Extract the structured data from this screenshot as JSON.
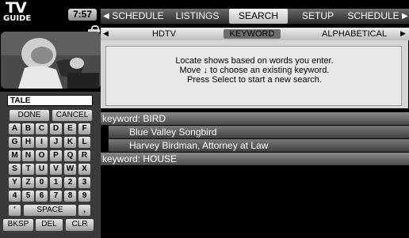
{
  "logo": {
    "line1": "TV",
    "line2": "GUIDE"
  },
  "clock": "7:57",
  "top_nav": {
    "items": [
      {
        "label": "SCHEDULE",
        "active": false
      },
      {
        "label": "LISTINGS",
        "active": false
      },
      {
        "label": "SEARCH",
        "active": true
      },
      {
        "label": "SETUP",
        "active": false
      },
      {
        "label": "SCHEDULE",
        "active": false
      }
    ]
  },
  "sub_nav": {
    "items": [
      {
        "label": "HDTV",
        "active": false
      },
      {
        "label": "KEYWORD",
        "active": true
      },
      {
        "label": "ALPHABETICAL",
        "active": false
      }
    ]
  },
  "info": {
    "line1": "Locate shows based on words you enter.",
    "line2": "Move ↓ to choose an existing keyword.",
    "line3": "Press Select to start a new search."
  },
  "keyboard": {
    "input_value": "TALE",
    "done": "DONE",
    "cancel": "CANCEL",
    "rows": [
      [
        "A",
        "B",
        "C",
        "D",
        "E",
        "F"
      ],
      [
        "G",
        "H",
        "I",
        "J",
        "K",
        "L"
      ],
      [
        "M",
        "N",
        "O",
        "P",
        "Q",
        "R"
      ],
      [
        "S",
        "T",
        "U",
        "V",
        "W",
        "X"
      ],
      [
        "Y",
        "Z",
        "0",
        "1",
        "2",
        "3"
      ],
      [
        "4",
        "5",
        "6",
        "7",
        "8",
        "9"
      ]
    ],
    "apostrophe": "'",
    "space": "SPACE",
    "comma": ",",
    "bksp": "BKSP",
    "del": "DEL",
    "clr": "CLR"
  },
  "results": [
    {
      "type": "keyword",
      "label": "keyword: BIRD"
    },
    {
      "type": "show",
      "label": "Blue Valley Songbird"
    },
    {
      "type": "show",
      "label": "Harvey Birdman, Attorney at Law"
    },
    {
      "type": "keyword",
      "label": "keyword: HOUSE"
    }
  ]
}
